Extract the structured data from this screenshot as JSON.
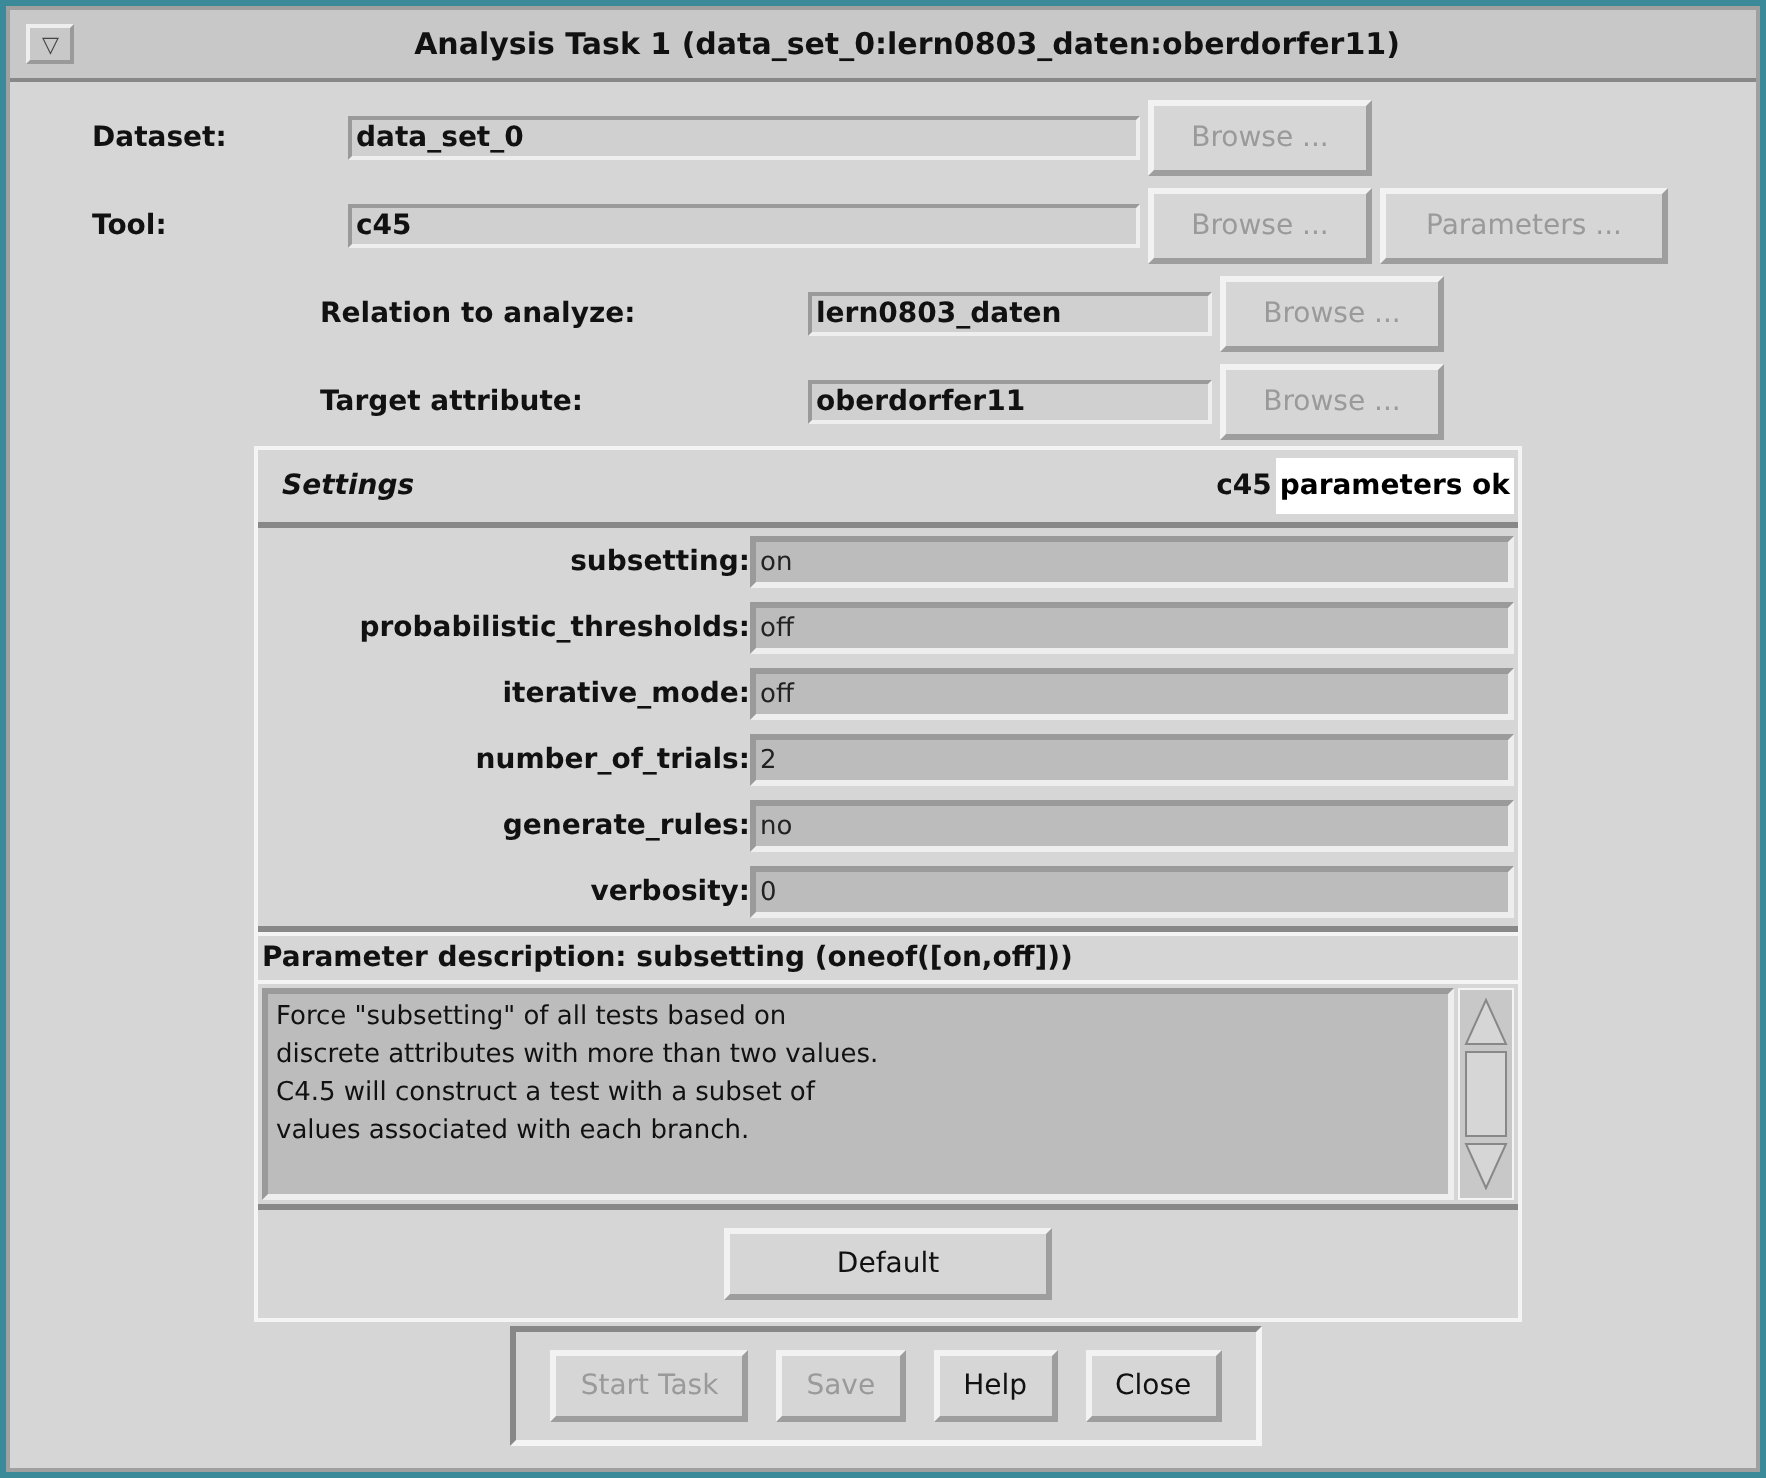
{
  "window": {
    "title": "Analysis Task 1 (data_set_0:lern0803_daten:oberdorfer11)",
    "menu_glyph": "▽"
  },
  "top_rows": [
    {
      "label": "Dataset:",
      "value": "data_set_0",
      "buttons": [
        {
          "label": "Browse ...",
          "disabled": true
        }
      ]
    },
    {
      "label": "Tool:",
      "value": "c45",
      "buttons": [
        {
          "label": "Browse ...",
          "disabled": true
        },
        {
          "label": "Parameters ...",
          "disabled": true
        }
      ]
    }
  ],
  "sub_rows": [
    {
      "label": "Relation to analyze:",
      "value": "lern0803_daten",
      "buttons": [
        {
          "label": "Browse ...",
          "disabled": true
        }
      ]
    },
    {
      "label": "Target attribute:",
      "value": "oberdorfer11",
      "buttons": [
        {
          "label": "Browse ...",
          "disabled": true
        }
      ]
    }
  ],
  "settings": {
    "title": "Settings",
    "status_tool": "c45",
    "status_message": "parameters ok",
    "parameters": [
      {
        "name": "subsetting:",
        "value": "on"
      },
      {
        "name": "probabilistic_thresholds:",
        "value": "off"
      },
      {
        "name": "iterative_mode:",
        "value": "off"
      },
      {
        "name": "number_of_trials:",
        "value": "2"
      },
      {
        "name": "generate_rules:",
        "value": "no"
      },
      {
        "name": "verbosity:",
        "value": "0"
      }
    ],
    "description_title": "Parameter description: subsetting (oneof([on,off]))",
    "description": "Force \"subsetting\" of all tests based on\ndiscrete attributes with more than two values.\nC4.5 will construct a test with a subset of\nvalues associated with each branch.",
    "default_button": {
      "label": "Default",
      "disabled": false
    }
  },
  "buttons": [
    {
      "label": "Start Task",
      "disabled": true
    },
    {
      "label": "Save",
      "disabled": true
    },
    {
      "label": "Help",
      "disabled": false
    },
    {
      "label": "Close",
      "disabled": false
    }
  ]
}
